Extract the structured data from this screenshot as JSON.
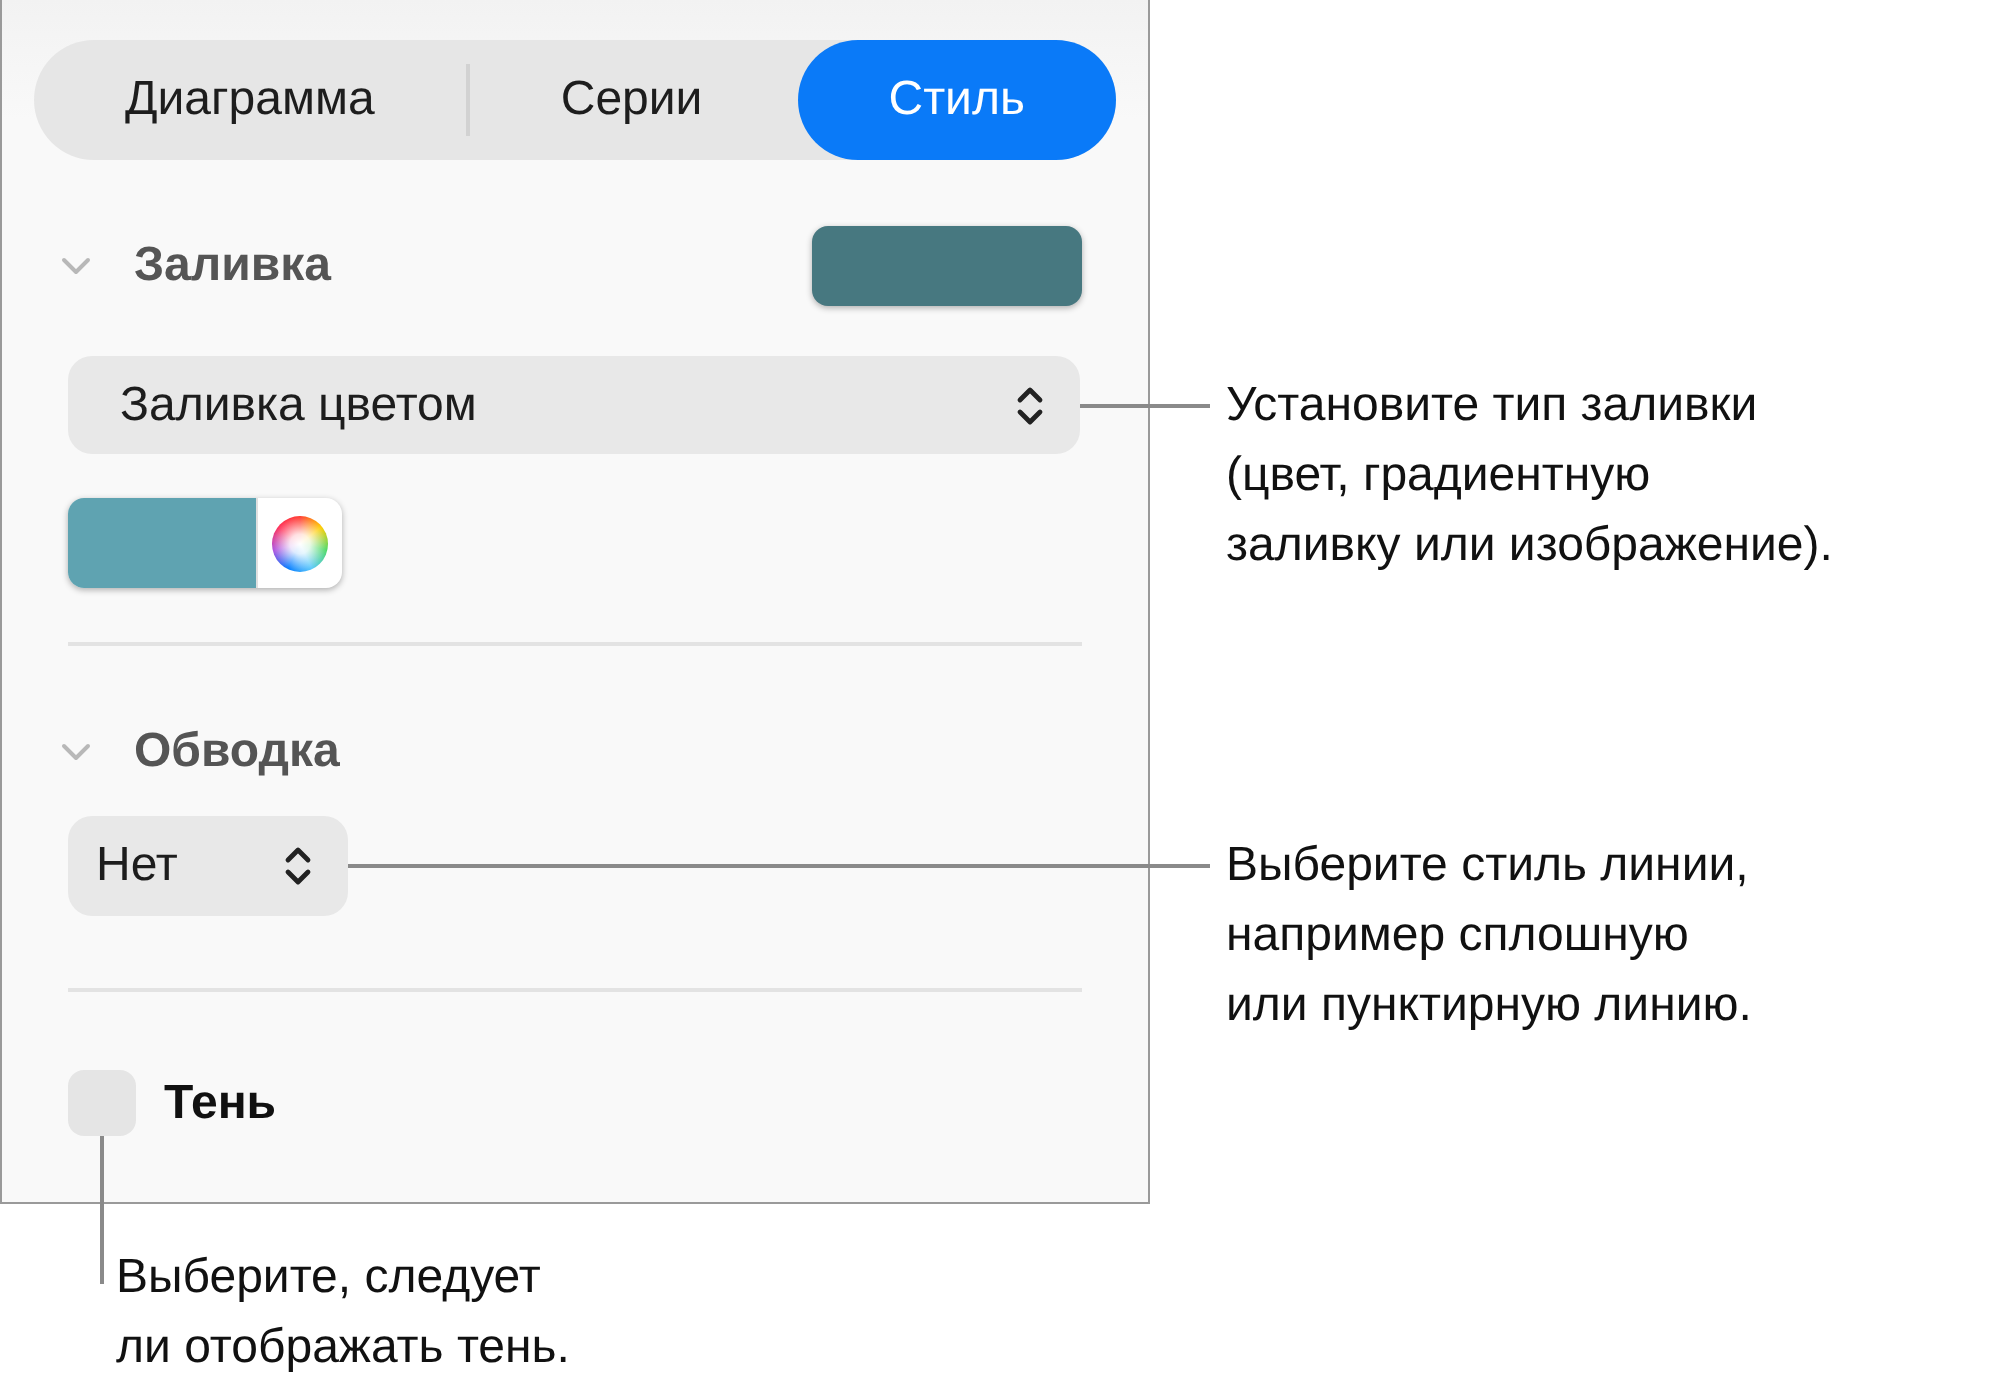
{
  "tabs": [
    {
      "label": "Диаграмма",
      "selected": false
    },
    {
      "label": "Серии",
      "selected": false
    },
    {
      "label": "Стиль",
      "selected": true
    }
  ],
  "fill": {
    "title": "Заливка",
    "expanded": true,
    "swatch": {
      "color": "#477880"
    },
    "fill_type": "Заливка цветом",
    "color_well": {
      "color": "#5fa3b1"
    },
    "callout": "Установите тип заливки\n(цвет, градиентную\nзаливку или изображение)."
  },
  "stroke": {
    "title": "Обводка",
    "expanded": true,
    "style": "Нет",
    "callout": "Выберите стиль линии,\nнапример сплошную\nили пунктирную линию."
  },
  "shadow": {
    "label": "Тень",
    "checked": false,
    "callout": "Выберите, следует\nли отображать тень."
  }
}
